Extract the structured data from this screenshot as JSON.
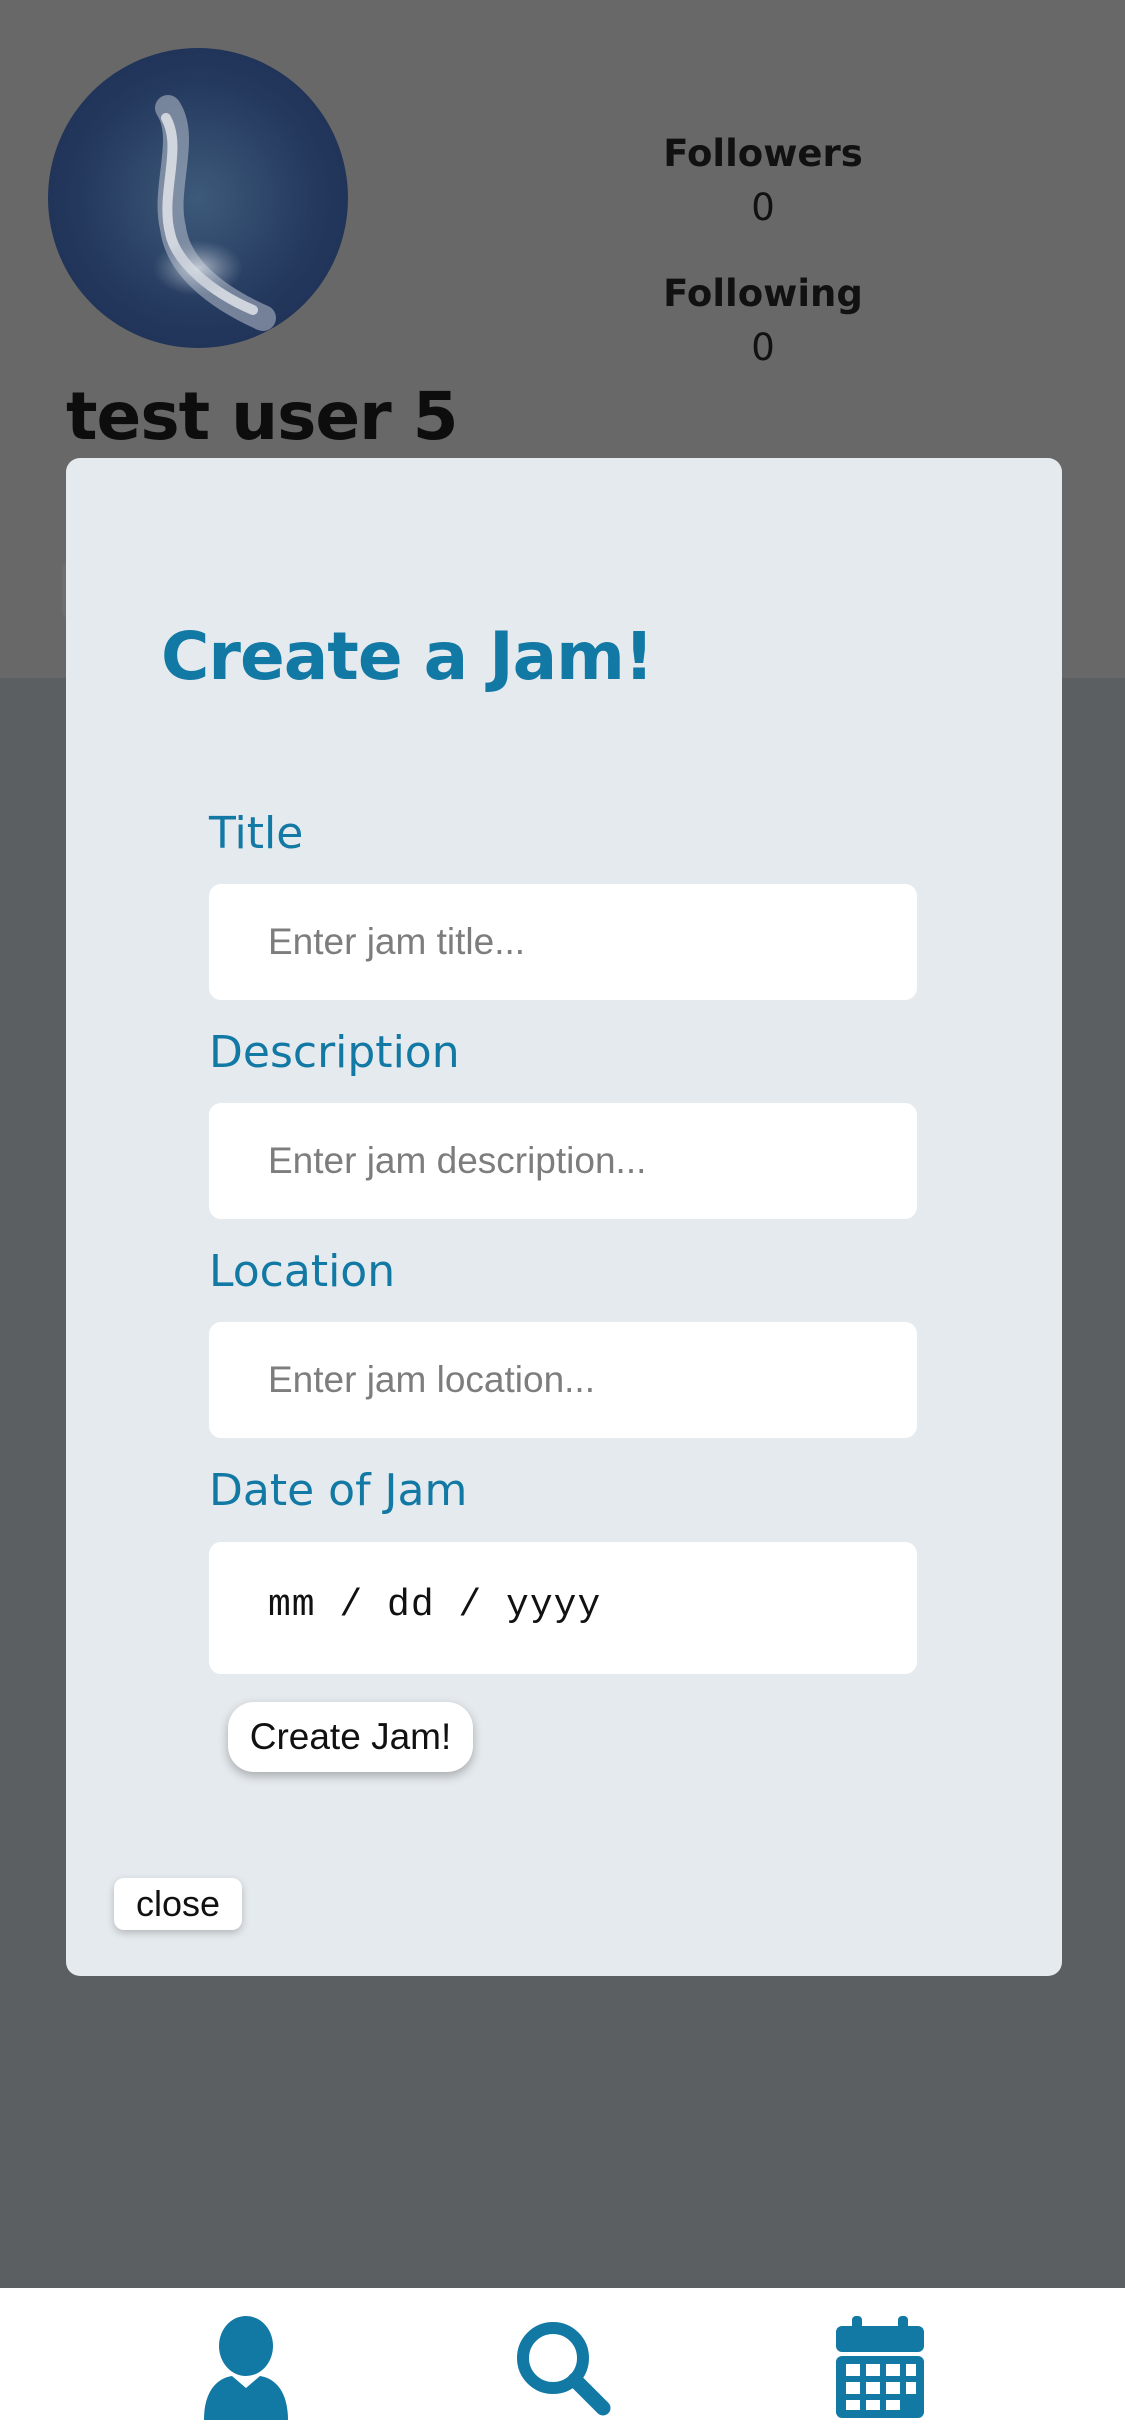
{
  "profile": {
    "username": "test user 5",
    "followers_label": "Followers",
    "followers_count": "0",
    "following_label": "Following",
    "following_count": "0",
    "avatar": "avatar-photo"
  },
  "modal": {
    "title": "Create a Jam!",
    "fields": [
      {
        "label": "Title",
        "placeholder": "Enter jam title...",
        "value": ""
      },
      {
        "label": "Description",
        "placeholder": "Enter jam description...",
        "value": ""
      },
      {
        "label": "Location",
        "placeholder": "Enter jam location...",
        "value": ""
      },
      {
        "label": "Date of Jam",
        "placeholder": "mm / dd / yyyy",
        "value": ""
      }
    ],
    "submit_label": "Create Jam!",
    "close_label": "close"
  },
  "bottom_nav": {
    "items": [
      {
        "icon": "user-icon"
      },
      {
        "icon": "search-icon"
      },
      {
        "icon": "calendar-icon"
      }
    ]
  },
  "colors": {
    "accent": "#1278a4",
    "modal_bg": "#e5eaee",
    "overlay_top": "#686868",
    "overlay_bottom": "#5c5f62"
  }
}
